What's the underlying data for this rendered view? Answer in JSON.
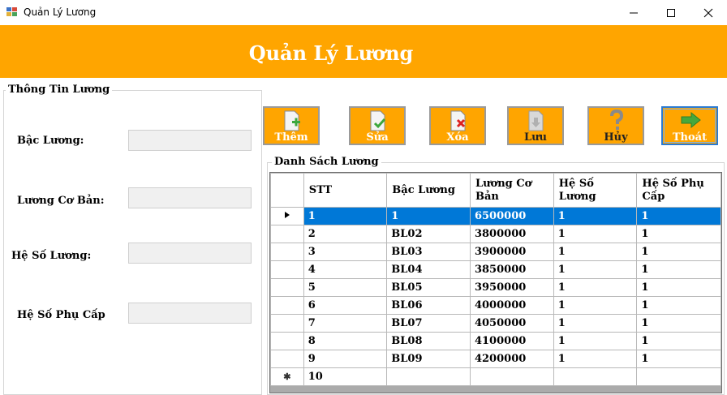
{
  "window": {
    "title": "Quản Lý Lương",
    "icon": "app-icon"
  },
  "banner": {
    "title": "Quản Lý Lương",
    "color": "#ffa500"
  },
  "info_group": {
    "legend": "Thông Tin Lương",
    "fields": [
      {
        "label": "Bậc Lương:",
        "value": ""
      },
      {
        "label": "Lương Cơ Bản:",
        "value": ""
      },
      {
        "label": "Hệ Số Lương:",
        "value": ""
      },
      {
        "label": "Hệ Số Phụ Cấp",
        "value": ""
      }
    ]
  },
  "toolbar": {
    "buttons": [
      {
        "label": "Thêm",
        "icon": "document-add-icon"
      },
      {
        "label": "Sửa",
        "icon": "document-check-icon"
      },
      {
        "label": "Xóa",
        "icon": "document-delete-icon"
      },
      {
        "label": "Lưu",
        "icon": "save-download-icon"
      },
      {
        "label": "Hủy",
        "icon": "question-mark-icon"
      },
      {
        "label": "Thoát",
        "icon": "exit-arrow-icon"
      }
    ]
  },
  "list_group": {
    "legend": "Danh Sách Lương",
    "columns": [
      "STT",
      "Bậc Lương",
      "Lương Cơ Bản",
      "Hệ Số Lương",
      "Hệ Số Phụ Cấp"
    ],
    "rows": [
      [
        "1",
        "1",
        "6500000",
        "1",
        "1"
      ],
      [
        "2",
        "BL02",
        "3800000",
        "1",
        "1"
      ],
      [
        "3",
        "BL03",
        "3900000",
        "1",
        "1"
      ],
      [
        "4",
        "BL04",
        "3850000",
        "1",
        "1"
      ],
      [
        "5",
        "BL05",
        "3950000",
        "1",
        "1"
      ],
      [
        "6",
        "BL06",
        "4000000",
        "1",
        "1"
      ],
      [
        "7",
        "BL07",
        "4050000",
        "1",
        "1"
      ],
      [
        "8",
        "BL08",
        "4100000",
        "1",
        "1"
      ],
      [
        "9",
        "BL09",
        "4200000",
        "1",
        "1"
      ]
    ],
    "new_row": [
      "10",
      "",
      "",
      "",
      ""
    ],
    "selected_row": 0,
    "selection_color": "#0078d7"
  }
}
